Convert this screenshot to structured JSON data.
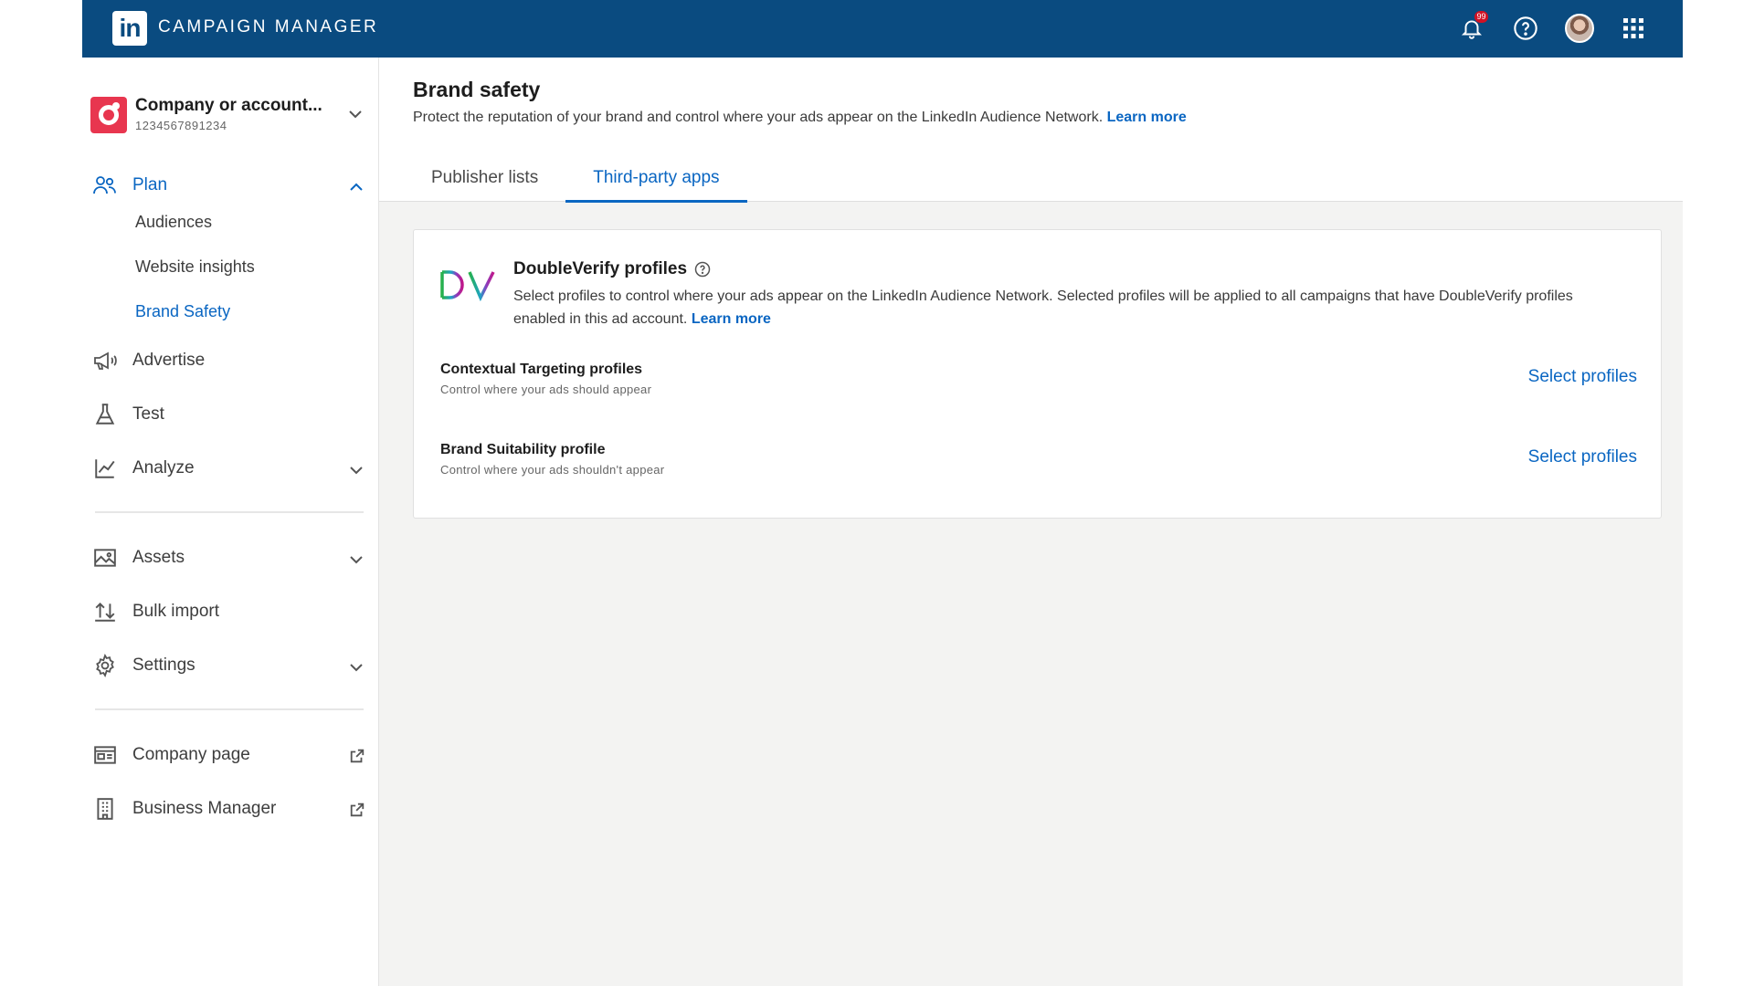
{
  "header": {
    "app_title": "CAMPAIGN MANAGER",
    "logo_text": "in",
    "notification_count": "99",
    "icons": [
      "bell-icon",
      "help-icon",
      "avatar",
      "apps-grid-icon"
    ]
  },
  "sidebar": {
    "account": {
      "name": "Company or account...",
      "id": "1234567891234"
    },
    "nav": {
      "plan": "Plan",
      "plan_sub": [
        "Audiences",
        "Website insights",
        "Brand Safety"
      ],
      "advertise": "Advertise",
      "test": "Test",
      "analyze": "Analyze",
      "assets": "Assets",
      "bulk_import": "Bulk import",
      "settings": "Settings",
      "company_page": "Company page",
      "business_manager": "Business Manager"
    }
  },
  "main": {
    "title": "Brand safety",
    "description": "Protect the reputation of your brand and control where your ads appear on the LinkedIn Audience Network.",
    "learn_more": "Learn more",
    "tabs": [
      "Publisher lists",
      "Third-party apps"
    ],
    "active_tab": "Third-party apps",
    "card": {
      "logo_text": "DV",
      "title": "DoubleVerify profiles",
      "description": "Select profiles to control where your ads appear on the LinkedIn Audience Network. Selected profiles will be applied to all campaigns that have DoubleVerify profiles enabled in this ad account.",
      "learn_more": "Learn more",
      "rows": [
        {
          "title": "Contextual Targeting profiles",
          "subtitle": "Control where your ads should appear",
          "action": "Select profiles"
        },
        {
          "title": "Brand Suitability profile",
          "subtitle": "Control where your ads shouldn't appear",
          "action": "Select profiles"
        }
      ]
    }
  },
  "colors": {
    "topbar": "#0a4b80",
    "accent": "#0a66c2",
    "account_logo": "#e8364f",
    "badge": "#d11124"
  }
}
